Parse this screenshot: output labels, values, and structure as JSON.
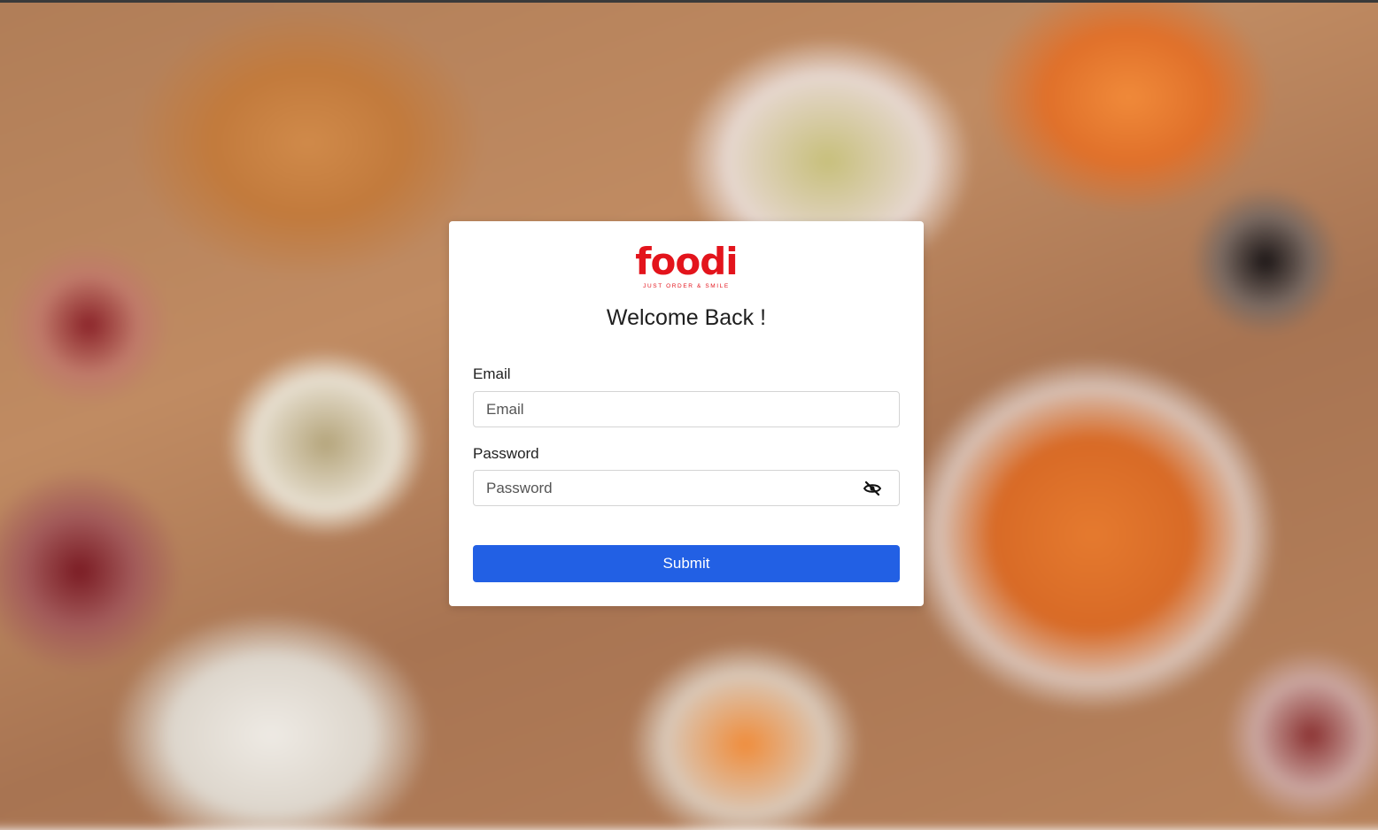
{
  "brand": {
    "name": "foodi",
    "tagline": "JUST ORDER & SMILE",
    "color": "#e3141c"
  },
  "login": {
    "title": "Welcome Back !",
    "email": {
      "label": "Email",
      "placeholder": "Email",
      "value": ""
    },
    "password": {
      "label": "Password",
      "placeholder": "Password",
      "value": "",
      "toggle_icon": "eye-slash-icon"
    },
    "submit_label": "Submit",
    "accent_color": "#2260e4"
  }
}
